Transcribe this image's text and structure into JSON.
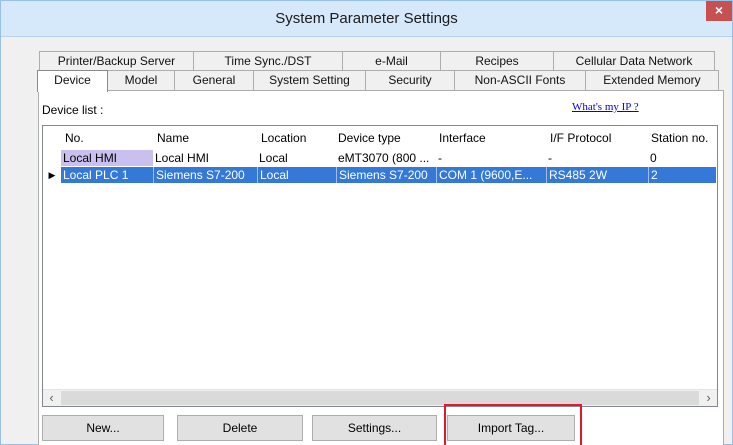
{
  "window": {
    "title": "System Parameter Settings",
    "close_label": "×"
  },
  "tabs_row1": [
    {
      "label": "Printer/Backup Server"
    },
    {
      "label": "Time Sync./DST"
    },
    {
      "label": "e-Mail"
    },
    {
      "label": "Recipes"
    },
    {
      "label": "Cellular Data Network"
    }
  ],
  "tabs_row2": [
    {
      "label": "Device",
      "active": true
    },
    {
      "label": "Model"
    },
    {
      "label": "General"
    },
    {
      "label": "System Setting"
    },
    {
      "label": "Security"
    },
    {
      "label": "Non-ASCII Fonts"
    },
    {
      "label": "Extended Memory"
    }
  ],
  "device_panel": {
    "list_label": "Device list :",
    "whats_my_ip": "What's my IP ?"
  },
  "table": {
    "columns": [
      "No.",
      "Name",
      "Location",
      "Device type",
      "Interface",
      "I/F Protocol",
      "Station no."
    ],
    "rows": [
      {
        "no": "Local HMI",
        "name": "Local HMI",
        "location": "Local",
        "device_type": "eMT3070 (800 ...",
        "interface": "-",
        "protocol": "-",
        "station": "0"
      },
      {
        "no": "Local PLC 1",
        "name": "Siemens S7-200",
        "location": "Local",
        "device_type": "Siemens S7-200",
        "interface": "COM 1 (9600,E...",
        "protocol": "RS485 2W",
        "station": "2"
      }
    ],
    "selected_marker": "▶",
    "scroll_left": "‹",
    "scroll_right": "›"
  },
  "buttons": {
    "new": "New...",
    "delete": "Delete",
    "settings": "Settings...",
    "import_tag": "Import Tag..."
  },
  "colors": {
    "selection": "#3478d8",
    "hmi_highlight": "#c9c0f0",
    "highlight_box": "#e0192c"
  }
}
